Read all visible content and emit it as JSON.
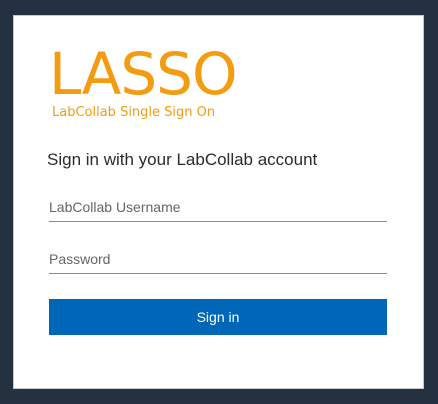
{
  "logo": {
    "title": "LASSO",
    "subtitle": "LabCollab Single Sign On",
    "color": "#f39c12"
  },
  "heading": "Sign in with your LabCollab account",
  "username": {
    "placeholder": "LabCollab Username",
    "value": ""
  },
  "password": {
    "placeholder": "Password",
    "value": ""
  },
  "signin_button": {
    "label": "Sign in",
    "color": "#0067b8"
  },
  "colors": {
    "page_background": "#243140",
    "card_background": "#ffffff"
  }
}
